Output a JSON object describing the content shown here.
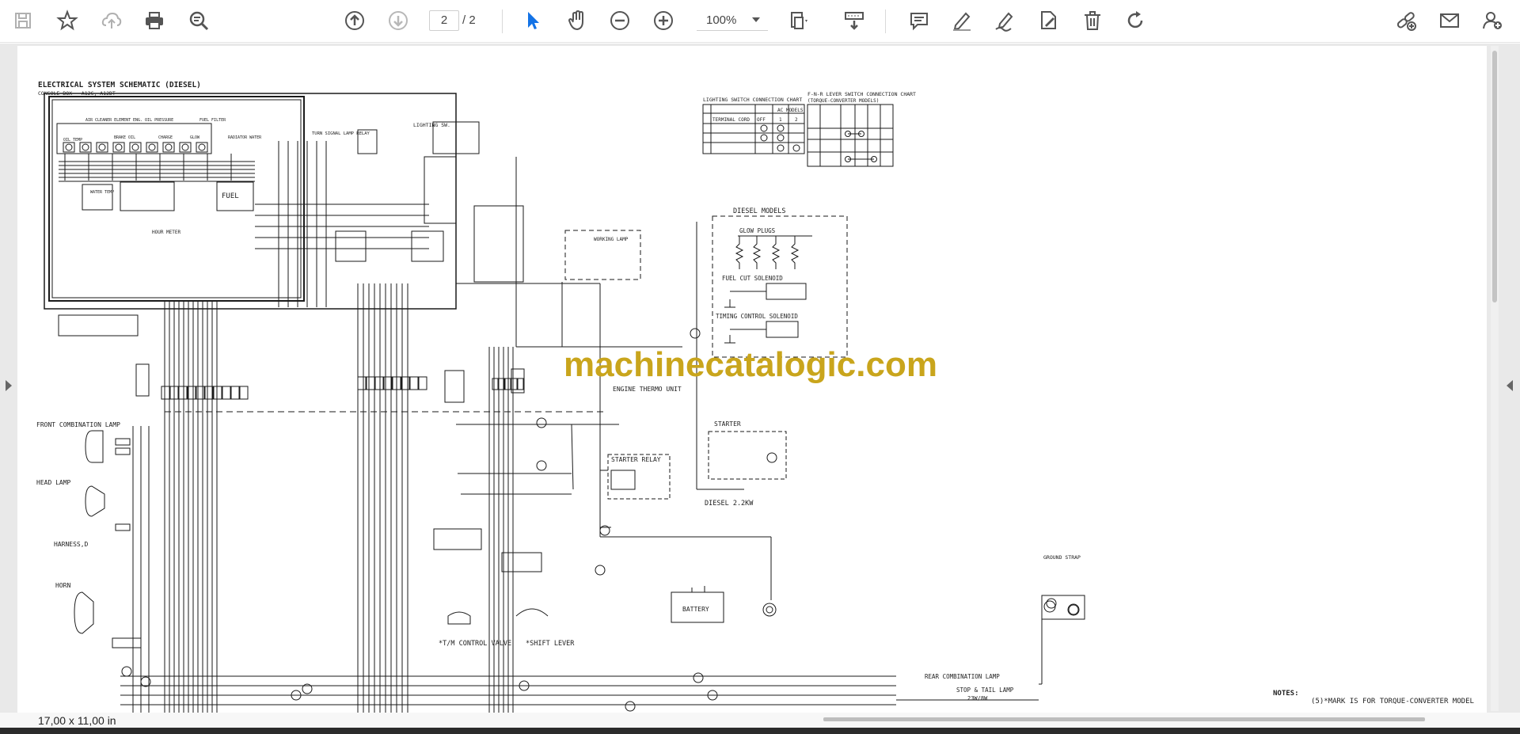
{
  "toolbar": {
    "page_current": "2",
    "page_total": "/ 2",
    "zoom": "100%",
    "icons": [
      "save-icon",
      "bookmark-star-icon",
      "cloud-upload-icon",
      "print-icon",
      "find-text-icon",
      "page-up-icon",
      "page-down-icon",
      "select-cursor-icon",
      "hand-pan-icon",
      "zoom-out-icon",
      "zoom-in-icon",
      "page-fit-icon",
      "scroll-mode-icon",
      "comment-icon",
      "highlight-pen-icon",
      "draw-icon",
      "fill-sign-icon",
      "delete-icon",
      "rotate-icon",
      "share-link-icon",
      "email-icon",
      "add-user-icon"
    ]
  },
  "document": {
    "title": "ELECTRICAL SYSTEM SCHEMATIC (DIESEL)",
    "subtitle": "CONSOLE BOX - A12C, A12DT",
    "watermark": "machinecatalogic.com",
    "labels": {
      "lighting_chart": "LIGHTING SWITCH CONNECTION CHART",
      "fnr_chart": "F-N-R LEVER SWITCH CONNECTION CHART",
      "fnr_chart_sub": "(TORQUE-CONVERTER MODELS)",
      "terminal_cord": "TERMINAL  CORD",
      "ac_models": "AC MODELS",
      "off": "OFF",
      "one": "1",
      "two": "2",
      "diesel_models": "DIESEL MODELS",
      "glow_plugs": "GLOW PLUGS",
      "fuel_cut": "FUEL CUT SOLENOID",
      "timing_control": "TIMING CONTROL SOLENOID",
      "working_lamp": "WORKING LAMP",
      "engine_thermo": "ENGINE THERMO UNIT",
      "starter": "STARTER",
      "starter_relay": "STARTER RELAY",
      "diesel_kw": "DIESEL   2.2KW",
      "battery": "BATTERY",
      "ground_strap": "GROUND STRAP",
      "front_combination_lamp": "FRONT COMBINATION LAMP",
      "head_lamp": "HEAD LAMP",
      "harness_d": "HARNESS,D",
      "horn": "HORN",
      "tm_control_valve": "*T/M CONTROL VALVE",
      "shift_lever": "*SHIFT LEVER",
      "rear_combination_lamp": "REAR COMBINATION LAMP",
      "stop_tail_lamp": "STOP & TAIL LAMP",
      "stop_tail_watt": "23W/8W",
      "hour_meter": "HOUR METER",
      "fuel": "FUEL",
      "lighting_sw": "LIGHTING SW.",
      "turn_signal": "TURN SIGNAL LAMP RELAY",
      "oil_temp": "OIL TEMP",
      "air_cleaner": "AIR CLEANER ELEMENT",
      "eng_oil": "ENG. OIL PRESSURE",
      "fuel_filter": "FUEL FILTER",
      "radiator_water": "RADIATOR WATER",
      "brake": "BRAKE OIL",
      "charge": "CHARGE",
      "glow": "GLOW",
      "water_temp": "WATER TEMP"
    },
    "notes_title": "NOTES:",
    "notes_line1": "(5)*MARK IS FOR TORQUE-CONVERTER MODEL"
  },
  "status": {
    "page_size": "17,00 x 11,00 in"
  }
}
